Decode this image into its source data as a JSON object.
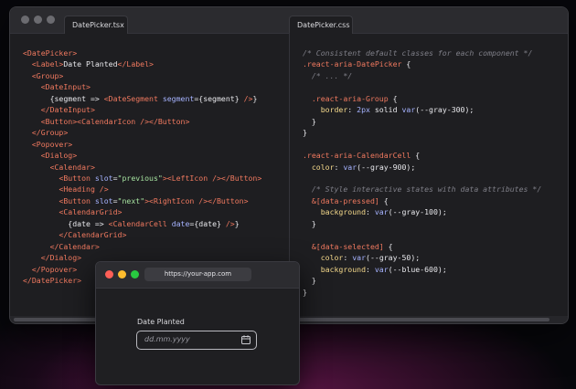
{
  "editor": {
    "tabs": [
      {
        "label": "DatePicker.tsx"
      },
      {
        "label": "DatePicker.css"
      }
    ]
  },
  "browser": {
    "url": "https://your-app.com",
    "field_label": "Date Planted",
    "placeholder": "dd.mm.yyyy",
    "traffic_colors": {
      "close": "#ff5f57",
      "minimize": "#febc2e",
      "maximize": "#28c840"
    }
  },
  "code": {
    "tsx_lines": [
      "<DatePicker>",
      "  <Label>Date Planted</Label>",
      "  <Group>",
      "    <DateInput>",
      "      {segment => <DateSegment segment={segment} />}",
      "    </DateInput>",
      "    <Button><CalendarIcon /></Button>",
      "  </Group>",
      "  <Popover>",
      "    <Dialog>",
      "      <Calendar>",
      "        <Button slot=\"previous\"><LeftIcon /></Button>",
      "        <Heading />",
      "        <Button slot=\"next\"><RightIcon /></Button>",
      "        <CalendarGrid>",
      "          {date => <CalendarCell date={date} />}",
      "        </CalendarGrid>",
      "      </Calendar>",
      "    </Dialog>",
      "  </Popover>",
      "</DatePicker>"
    ],
    "css_lines": [
      "/* Consistent default classes for each component */",
      ".react-aria-DatePicker {",
      "  /* ... */",
      "",
      "  .react-aria-Group {",
      "    border: 2px solid var(--gray-300);",
      "  }",
      "}",
      "",
      ".react-aria-CalendarCell {",
      "  color: var(--gray-900);",
      "",
      "  /* Style interactive states with data attributes */",
      "  &[data-pressed] {",
      "    background: var(--gray-100);",
      "  }",
      "",
      "  &[data-selected] {",
      "    color: var(--gray-50);",
      "    background: var(--blue-600);",
      "  }",
      "}"
    ]
  },
  "colors": {
    "tag": "#f0795f",
    "attr": "#a6b3ff",
    "string": "#a6e3a0",
    "property": "#f5d98b",
    "comment": "#7f7f88"
  }
}
